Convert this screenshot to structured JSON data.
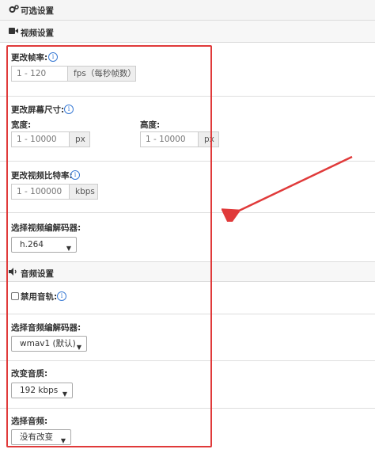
{
  "sections": {
    "optional_label": "可选设置",
    "video_label": "视频设置",
    "audio_label": "音频设置"
  },
  "video": {
    "fps": {
      "label": "更改帧率:",
      "placeholder": "1 - 120",
      "unit": "fps（每秒帧数）"
    },
    "screen_size": {
      "label": "更改屏幕尺寸:",
      "width_label": "宽度:",
      "width_placeholder": "1 - 10000",
      "height_label": "高度:",
      "height_placeholder": "1 - 10000",
      "unit": "px"
    },
    "bitrate": {
      "label": "更改视频比特率:",
      "placeholder": "1 - 100000",
      "unit": "kbps"
    },
    "codec": {
      "label": "选择视频编解码器:",
      "selected": "h.264"
    }
  },
  "audio": {
    "disable": {
      "label": "禁用音轨:"
    },
    "codec": {
      "label": "选择音频编解码器:",
      "selected": "wmav1 (默认)"
    },
    "quality": {
      "label": "改变音质:",
      "selected": "192 kbps"
    },
    "frequency": {
      "label": "选择音频:",
      "selected": "没有改变"
    }
  },
  "icons": {
    "info": "i",
    "caret": "▼"
  },
  "colors": {
    "annotation_red": "#e03a3a",
    "info_blue": "#3a7bd5"
  }
}
